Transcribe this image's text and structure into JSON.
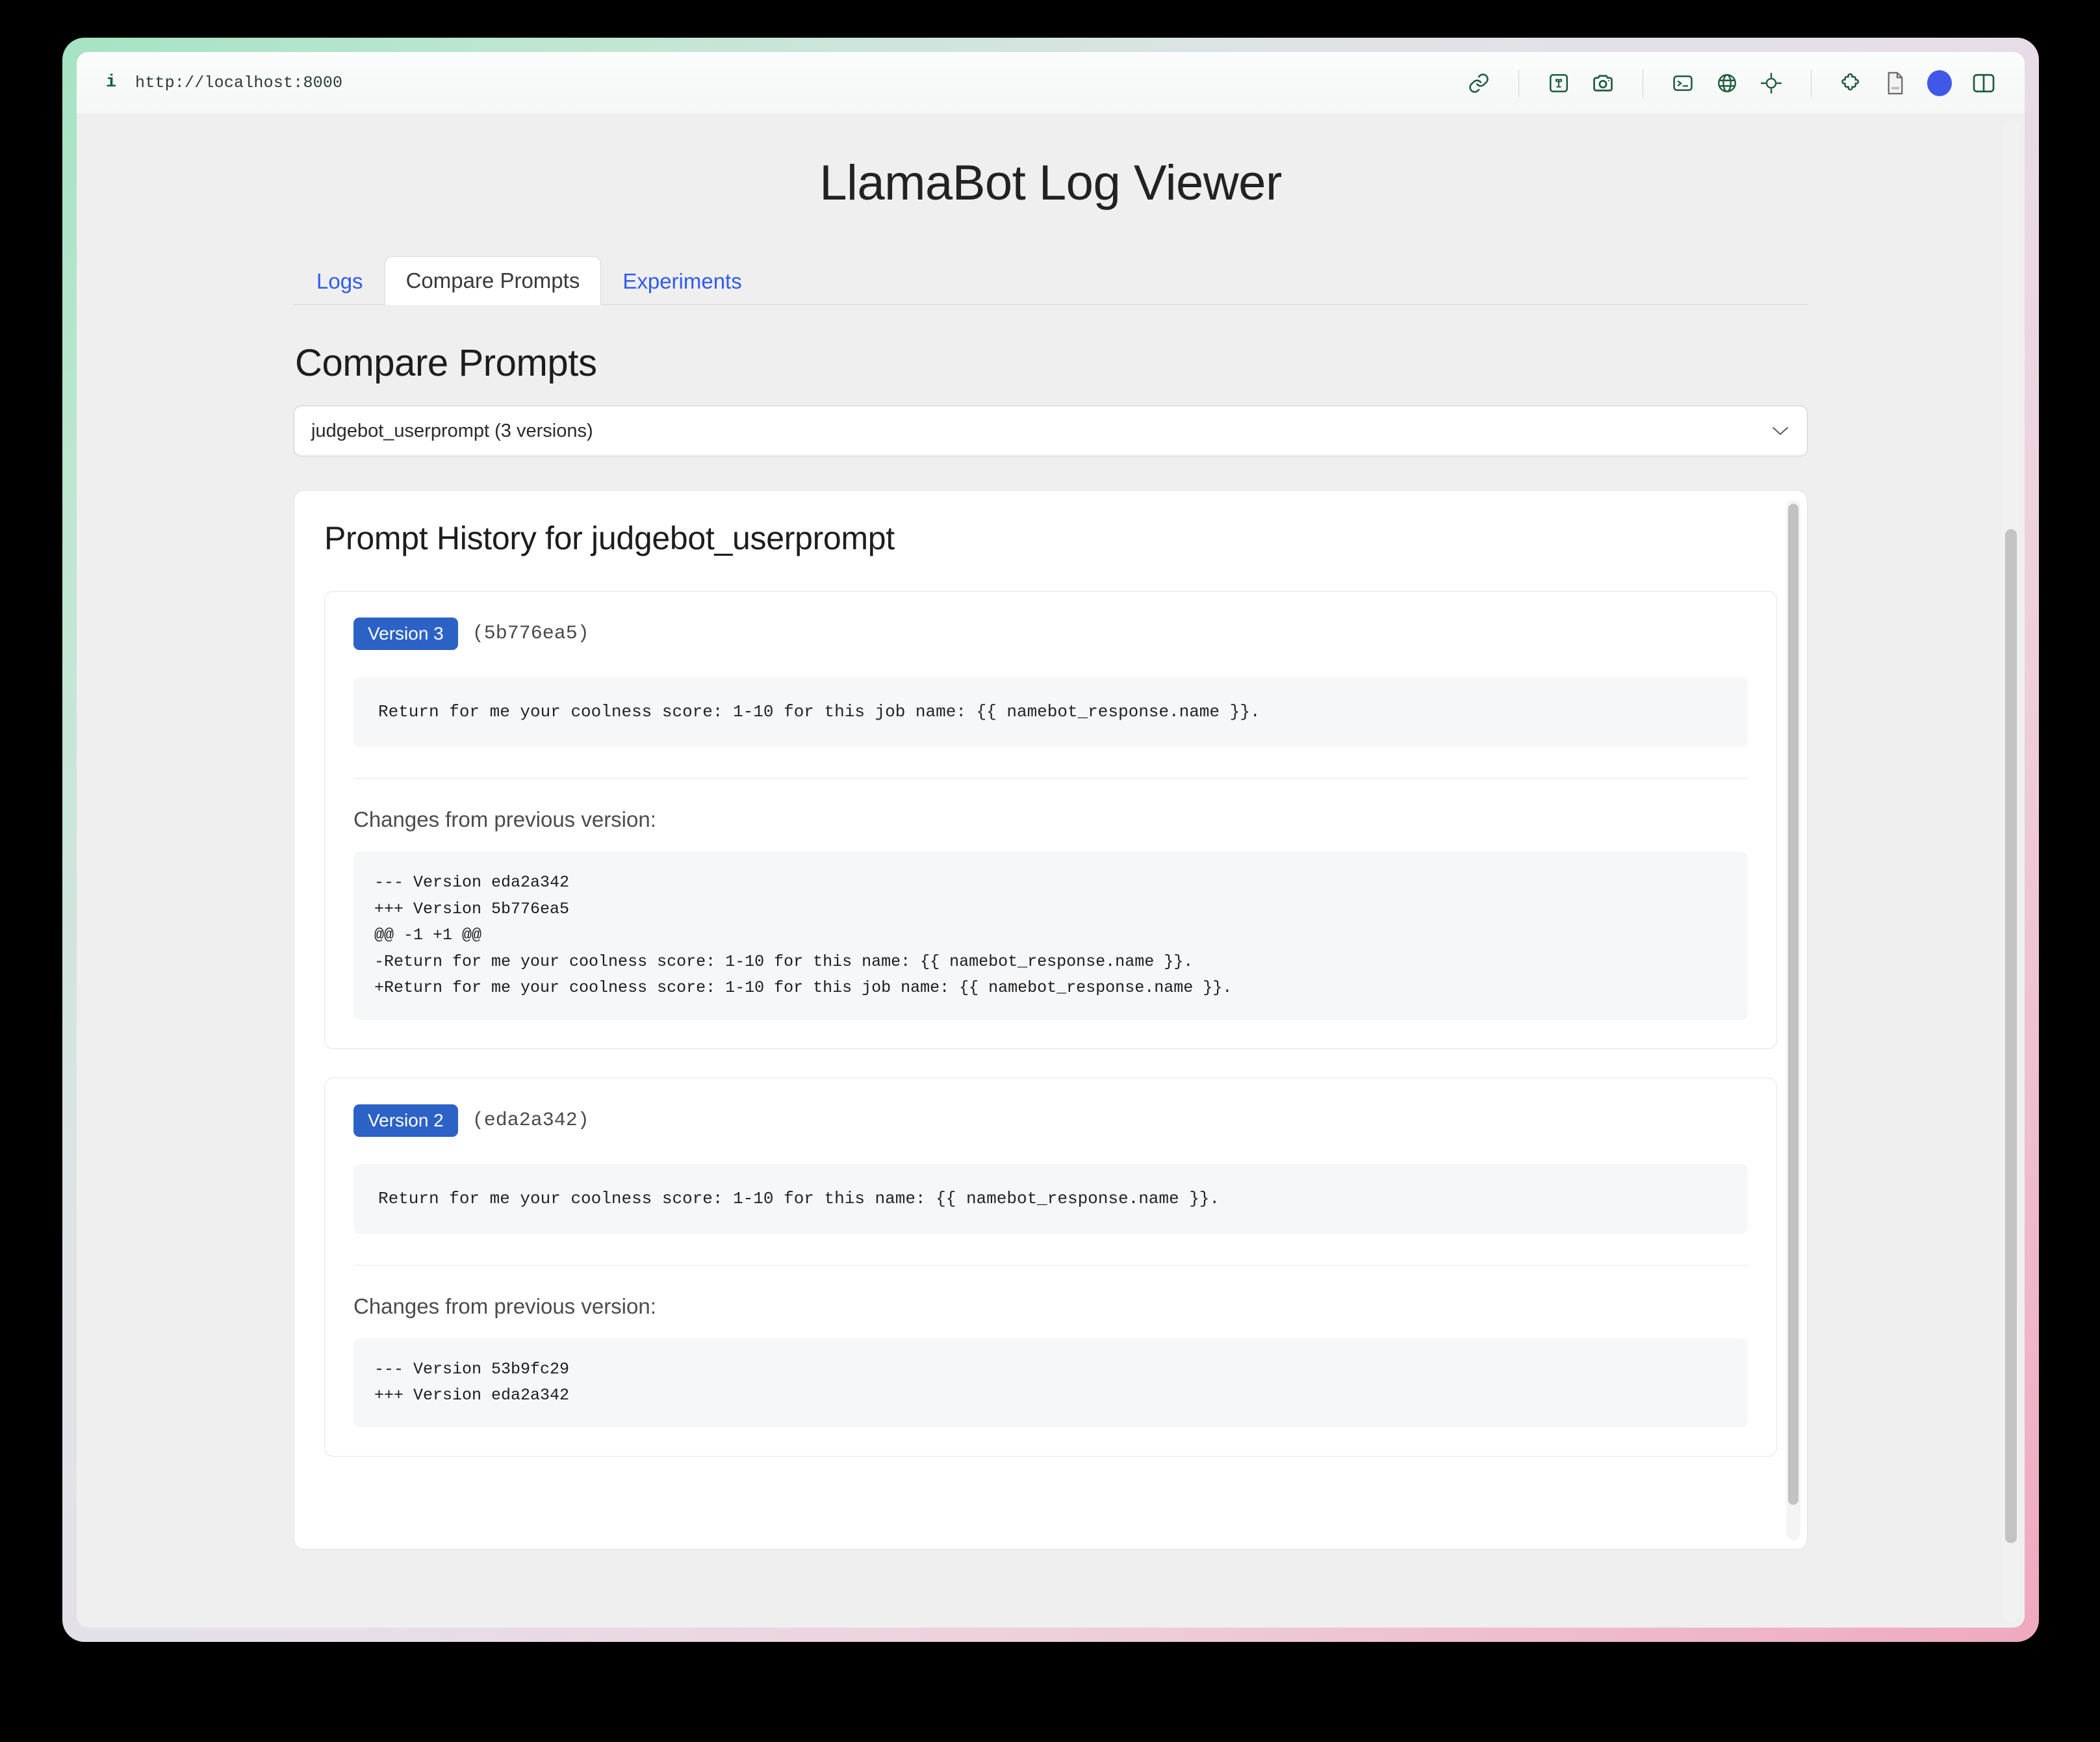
{
  "browser": {
    "info_icon": "info-icon",
    "url": "http://localhost:8000",
    "toolbar_icons": [
      {
        "name": "link-icon",
        "title": "Link"
      },
      {
        "name": "image-icon",
        "title": "Image"
      },
      {
        "name": "camera-icon",
        "title": "Camera"
      },
      {
        "name": "terminal-icon",
        "title": "Terminal"
      },
      {
        "name": "globe-icon",
        "title": "Globe"
      },
      {
        "name": "target-icon",
        "title": "Target"
      },
      {
        "name": "puzzle-icon",
        "title": "Extensions"
      },
      {
        "name": "document-icon",
        "title": "Document"
      },
      {
        "name": "status-dot",
        "title": "Status"
      },
      {
        "name": "split-panel-icon",
        "title": "Split panel"
      }
    ]
  },
  "app": {
    "title": "LlamaBot Log Viewer"
  },
  "tabs": [
    {
      "label": "Logs",
      "active": false
    },
    {
      "label": "Compare Prompts",
      "active": true
    },
    {
      "label": "Experiments",
      "active": false
    }
  ],
  "main": {
    "section_title": "Compare Prompts",
    "prompt_select": {
      "value": "judgebot_userprompt (3 versions)",
      "options": [
        "judgebot_userprompt (3 versions)"
      ]
    },
    "panel_heading": "Prompt History for judgebot_userprompt",
    "changes_label": "Changes from previous version:",
    "versions": [
      {
        "badge": "Version 3",
        "hash": "(5b776ea5)",
        "prompt": "Return for me your coolness score: 1-10 for this job name: {{ namebot_response.name }}.",
        "changes_label": "Changes from previous version:",
        "diff": "--- Version eda2a342\n+++ Version 5b776ea5\n@@ -1 +1 @@\n-Return for me your coolness score: 1-10 for this name: {{ namebot_response.name }}.\n+Return for me your coolness score: 1-10 for this job name: {{ namebot_response.name }}."
      },
      {
        "badge": "Version 2",
        "hash": "(eda2a342)",
        "prompt": "Return for me your coolness score: 1-10 for this name: {{ namebot_response.name }}.",
        "changes_label": "Changes from previous version:",
        "diff": "--- Version 53b9fc29\n+++ Version eda2a342"
      }
    ]
  },
  "colors": {
    "accent_blue": "#2c62c6",
    "link_blue": "#2f5cf0",
    "status_dot": "#4058e8",
    "icon_green": "#1f5c3c",
    "page_bg": "#efefef"
  }
}
